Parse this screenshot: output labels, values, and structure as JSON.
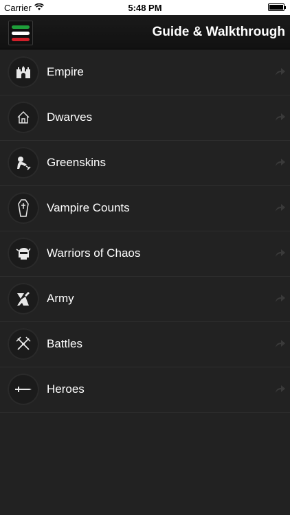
{
  "status": {
    "carrier": "Carrier",
    "time": "5:48 PM"
  },
  "header": {
    "title": "Guide & Walkthrough",
    "menu_colors": [
      "#1e9e3a",
      "#ffffff",
      "#d0202a"
    ]
  },
  "menu": {
    "items": [
      {
        "label": "Empire",
        "icon": "castle-icon"
      },
      {
        "label": "Dwarves",
        "icon": "house-icon"
      },
      {
        "label": "Greenskins",
        "icon": "orc-icon"
      },
      {
        "label": "Vampire Counts",
        "icon": "coffin-icon"
      },
      {
        "label": "Warriors of Chaos",
        "icon": "helmet-icon"
      },
      {
        "label": "Army",
        "icon": "soldier-icon"
      },
      {
        "label": "Battles",
        "icon": "crossed-swords-icon"
      },
      {
        "label": "Heroes",
        "icon": "sword-icon"
      }
    ]
  }
}
